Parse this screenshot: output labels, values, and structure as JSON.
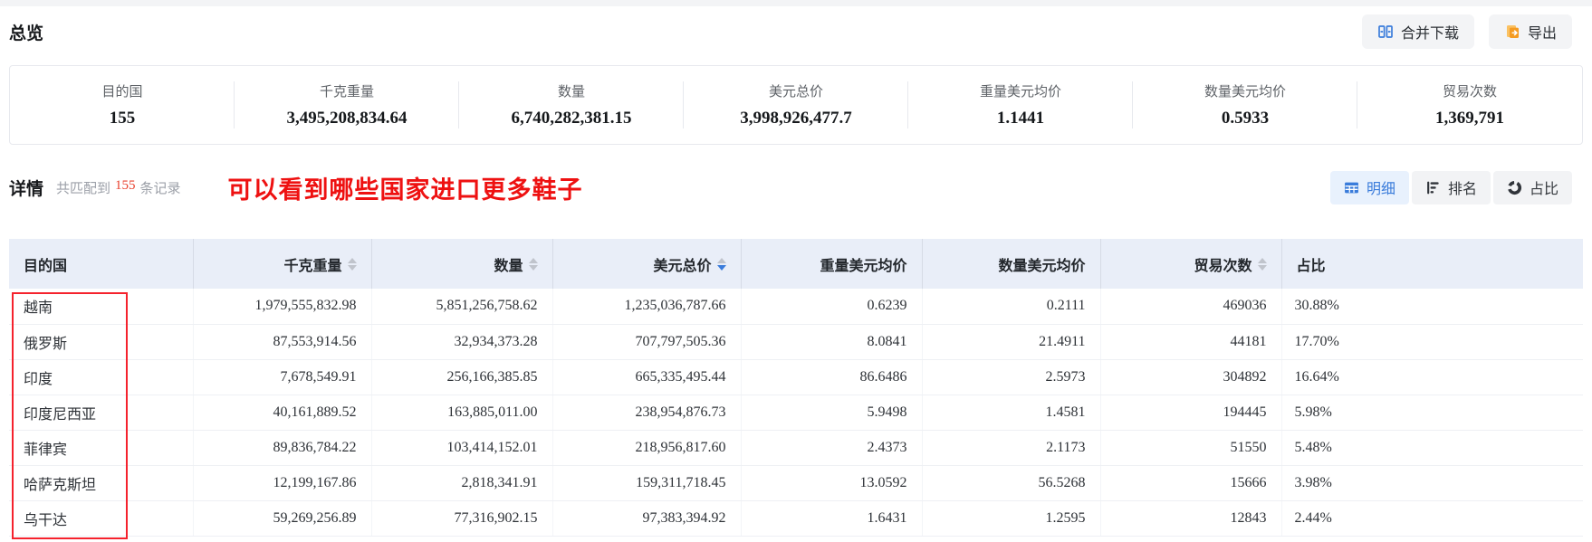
{
  "overview": {
    "title": "总览"
  },
  "toolbar": {
    "merge_download_label": "合并下载",
    "export_label": "导出"
  },
  "stats": [
    {
      "key": "dest-country-count",
      "label": "目的国",
      "value": "155"
    },
    {
      "key": "kg-weight",
      "label": "千克重量",
      "value": "3,495,208,834.64"
    },
    {
      "key": "quantity",
      "label": "数量",
      "value": "6,740,282,381.15"
    },
    {
      "key": "usd-total",
      "label": "美元总价",
      "value": "3,998,926,477.7"
    },
    {
      "key": "weight-usd-avg",
      "label": "重量美元均价",
      "value": "1.1441"
    },
    {
      "key": "qty-usd-avg",
      "label": "数量美元均价",
      "value": "0.5933"
    },
    {
      "key": "trade-count",
      "label": "贸易次数",
      "value": "1,369,791"
    }
  ],
  "details": {
    "title": "详情",
    "matched_prefix": "共匹配到",
    "matched_count": "155",
    "matched_suffix": "条记录",
    "annotation": "可以看到哪些国家进口更多鞋子",
    "view_tabs": [
      {
        "key": "detail",
        "icon": "table-icon",
        "label": "明细",
        "active": true
      },
      {
        "key": "rank",
        "icon": "rank-icon",
        "label": "排名",
        "active": false
      },
      {
        "key": "share",
        "icon": "pie-icon",
        "label": "占比",
        "active": false
      }
    ]
  },
  "table": {
    "columns": [
      {
        "key": "dest-country",
        "label": "目的国",
        "sortable": false,
        "align": "left"
      },
      {
        "key": "kg-weight",
        "label": "千克重量",
        "sortable": true,
        "align": "right"
      },
      {
        "key": "quantity",
        "label": "数量",
        "sortable": true,
        "align": "right"
      },
      {
        "key": "usd-total",
        "label": "美元总价",
        "sortable": true,
        "sort": "desc",
        "align": "right"
      },
      {
        "key": "weight-usd-avg",
        "label": "重量美元均价",
        "sortable": false,
        "align": "right"
      },
      {
        "key": "qty-usd-avg",
        "label": "数量美元均价",
        "sortable": false,
        "align": "right"
      },
      {
        "key": "trade-count",
        "label": "贸易次数",
        "sortable": true,
        "align": "right"
      },
      {
        "key": "share",
        "label": "占比",
        "sortable": false,
        "align": "left"
      }
    ],
    "rows": [
      [
        "越南",
        "1,979,555,832.98",
        "5,851,256,758.62",
        "1,235,036,787.66",
        "0.6239",
        "0.2111",
        "469036",
        "30.88%"
      ],
      [
        "俄罗斯",
        "87,553,914.56",
        "32,934,373.28",
        "707,797,505.36",
        "8.0841",
        "21.4911",
        "44181",
        "17.70%"
      ],
      [
        "印度",
        "7,678,549.91",
        "256,166,385.85",
        "665,335,495.44",
        "86.6486",
        "2.5973",
        "304892",
        "16.64%"
      ],
      [
        "印度尼西亚",
        "40,161,889.52",
        "163,885,011.00",
        "238,954,876.73",
        "5.9498",
        "1.4581",
        "194445",
        "5.98%"
      ],
      [
        "菲律宾",
        "89,836,784.22",
        "103,414,152.01",
        "218,956,817.60",
        "2.4373",
        "2.1173",
        "51550",
        "5.48%"
      ],
      [
        "哈萨克斯坦",
        "12,199,167.86",
        "2,818,341.91",
        "159,311,718.45",
        "13.0592",
        "56.5268",
        "15666",
        "3.98%"
      ],
      [
        "乌干达",
        "59,269,256.89",
        "77,316,902.15",
        "97,383,394.92",
        "1.6431",
        "1.2595",
        "12843",
        "2.44%"
      ]
    ]
  },
  "colors": {
    "accent_blue": "#3a7cdb",
    "tab_active_bg": "#e8f1fd",
    "header_bg": "#e9eef8",
    "annotation_red": "#ee1111",
    "count_red": "#e8402d",
    "export_orange": "#f59b22"
  }
}
